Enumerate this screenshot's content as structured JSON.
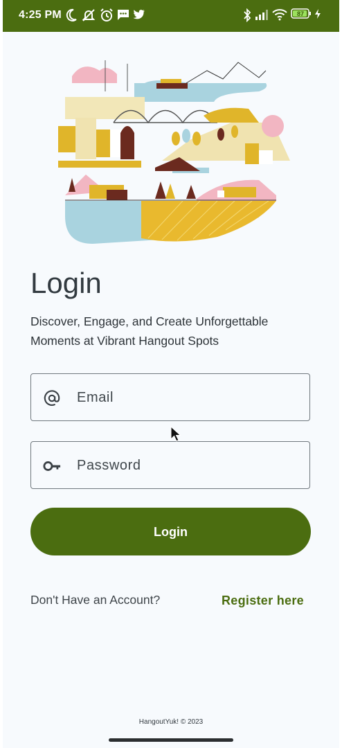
{
  "status_bar": {
    "time": "4:25 PM",
    "battery_level": "87",
    "left_icons": [
      "moon-icon",
      "notifications-off-icon",
      "alarm-icon",
      "message-icon",
      "twitter-icon"
    ],
    "right_icons": [
      "bluetooth-icon",
      "signal-icon",
      "wifi-icon",
      "battery-icon",
      "charging-icon"
    ]
  },
  "illustration": {
    "icon": "city-landscape-illustration"
  },
  "login": {
    "title": "Login",
    "subtitle": "Discover, Engage, and Create Unforgettable Moments at Vibrant Hangout Spots",
    "email": {
      "placeholder": "Email",
      "value": "",
      "icon": "at-icon"
    },
    "password": {
      "placeholder": "Password",
      "value": "",
      "icon": "key-icon"
    },
    "button_label": "Login"
  },
  "register": {
    "prompt": "Don't Have an Account?",
    "link_label": "Register here"
  },
  "footer": {
    "copyright": "HangoutYuk! © 2023"
  },
  "colors": {
    "primary": "#4b6d10",
    "background": "#f7fafd",
    "text": "#323a40"
  }
}
